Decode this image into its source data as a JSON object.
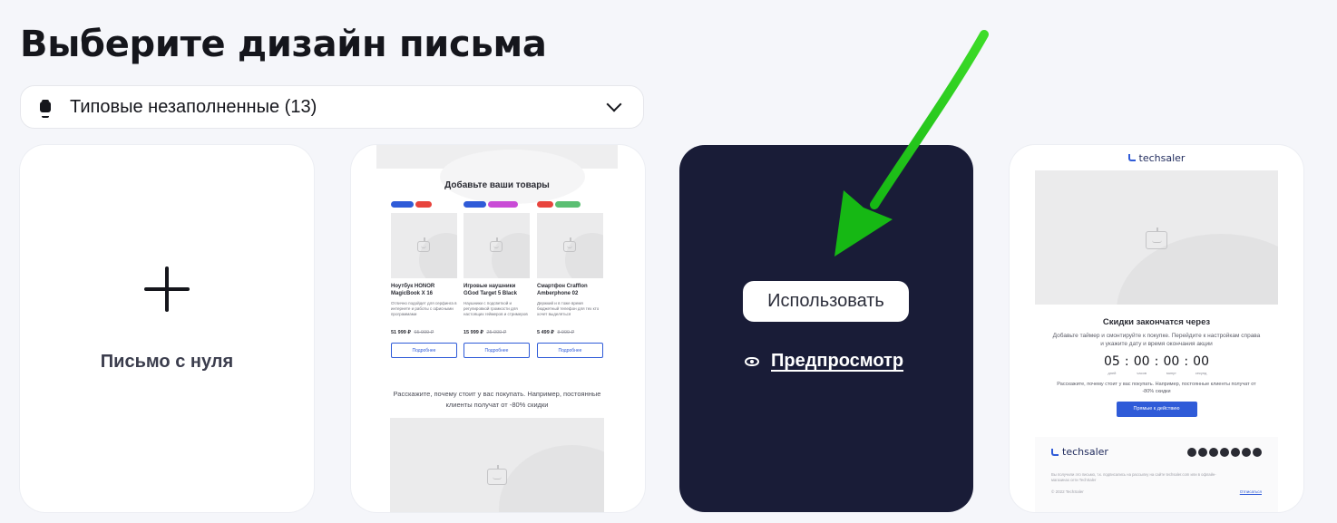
{
  "page": {
    "title": "Выберите дизайн письма"
  },
  "category_select": {
    "value": "Типовые незаполненные (13)",
    "icon": "templates-icon"
  },
  "cards": {
    "blank": {
      "label": "Письмо с нуля",
      "icon": "plus-icon"
    },
    "hovered": {
      "use_label": "Использовать",
      "preview_label": "Предпросмотр",
      "preview_icon": "eye-icon"
    }
  },
  "template_products": {
    "heading": "Добавьте ваши товары",
    "products": [
      {
        "tags": [
          "#2f5bd8",
          "#e8443d"
        ],
        "name": "Ноутбук HONOR MagicBook X 16",
        "desc": "Отлично подойдет для серфинга в интернете и работы с офисными программами",
        "price": "51 999 ₽",
        "old_price": "65 999 ₽",
        "button": "Подробнее"
      },
      {
        "tags": [
          "#2f5bd8",
          "#c94bd6"
        ],
        "name": "Игровые наушники GGod Target 5 Black",
        "desc": "Наушники с подсветкой и регулировкой громкости для настоящих геймеров и стримеров",
        "price": "15 999 ₽",
        "old_price": "25 000 ₽",
        "button": "Подробнее"
      },
      {
        "tags": [
          "#e8443d",
          "#5bbf73"
        ],
        "name": "Смартфон Crafflon Amberphone 02",
        "desc": "Держкий и в тоже время бюджетный телефон для тех кто хочет выделяться",
        "price": "5 499 ₽",
        "old_price": "8 999 ₽",
        "button": "Подробнее"
      }
    ],
    "text": "Расскажите, почему стоит у вас покупать. Например, постоянные клиенты получат от -80% скидки"
  },
  "template_timer": {
    "brand": "techsaler",
    "title": "Скидки закончатся через",
    "desc": "Добавьте таймер и смонтируйте к покупке. Перейдите к настройкам справа и укажите дату и время окончания акции",
    "timer": [
      {
        "num": "05",
        "unit": "дней"
      },
      {
        "num": "00",
        "unit": "часов"
      },
      {
        "num": "00",
        "unit": "минут"
      },
      {
        "num": "00",
        "unit": "секунд"
      }
    ],
    "note": "Расскажите, почему стоит у вас покупать. Например, постоянные клиенты получат от -80% скидки",
    "cta": "Прямые к действию",
    "footer_brand": "techsaler",
    "legal": "Вы получили это письмо, т.к. подписались на рассылку на сайте techsaler.com или в офлайн-магазинах сети TechSaler",
    "copyright": "© 2022 TechSaler",
    "unsubscribe": "Отписаться"
  },
  "colors": {
    "hover_card": "#191c37",
    "accent_arrow": "#1fc51a",
    "link_blue": "#2f5bd8"
  }
}
